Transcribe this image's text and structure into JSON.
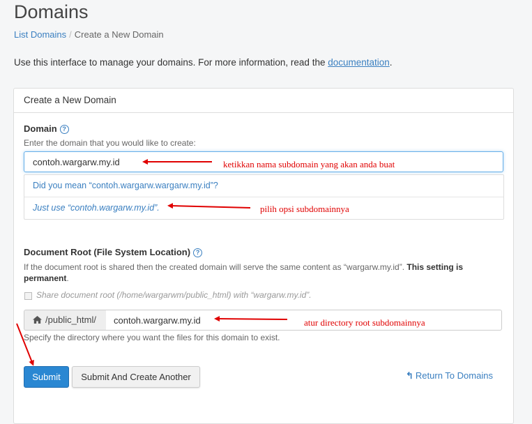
{
  "page": {
    "title": "Domains",
    "breadcrumb": {
      "link": "List Domains",
      "separator": "/",
      "current": "Create a New Domain"
    },
    "intro": {
      "text": "Use this interface to manage your domains. For more information, read the ",
      "link": "documentation",
      "end": "."
    }
  },
  "panel": {
    "heading": "Create a New Domain",
    "domain": {
      "label": "Domain",
      "hint": "Enter the domain that you would like to create:",
      "value": "contoh.wargarw.my.id",
      "suggestions": [
        "Did you mean “contoh.wargarw.wargarw.my.id”?",
        "Just use “contoh.wargarw.my.id”."
      ]
    },
    "docroot": {
      "label": "Document Root (File System Location)",
      "hint_text": "If the document root is shared then the created domain will serve the same content as “wargarw.my.id”. ",
      "hint_bold": "This setting is permanent",
      "hint_end": ".",
      "checkbox_label": "Share document root (/home/wargarwm/public_html) with “wargarw.my.id”.",
      "prefix": "/public_html/",
      "value": "contoh.wargarw.my.id",
      "help": "Specify the directory where you want the files for this domain to exist."
    },
    "buttons": {
      "submit": "Submit",
      "submit_another": "Submit And Create Another",
      "return": "Return To Domains"
    }
  },
  "annotations": {
    "domain_note": "ketikkan nama subdomain yang akan anda buat",
    "option_note": "pilih opsi subdomainnya",
    "root_note": "atur directory root subdomainnya",
    "color": "#e00000"
  }
}
